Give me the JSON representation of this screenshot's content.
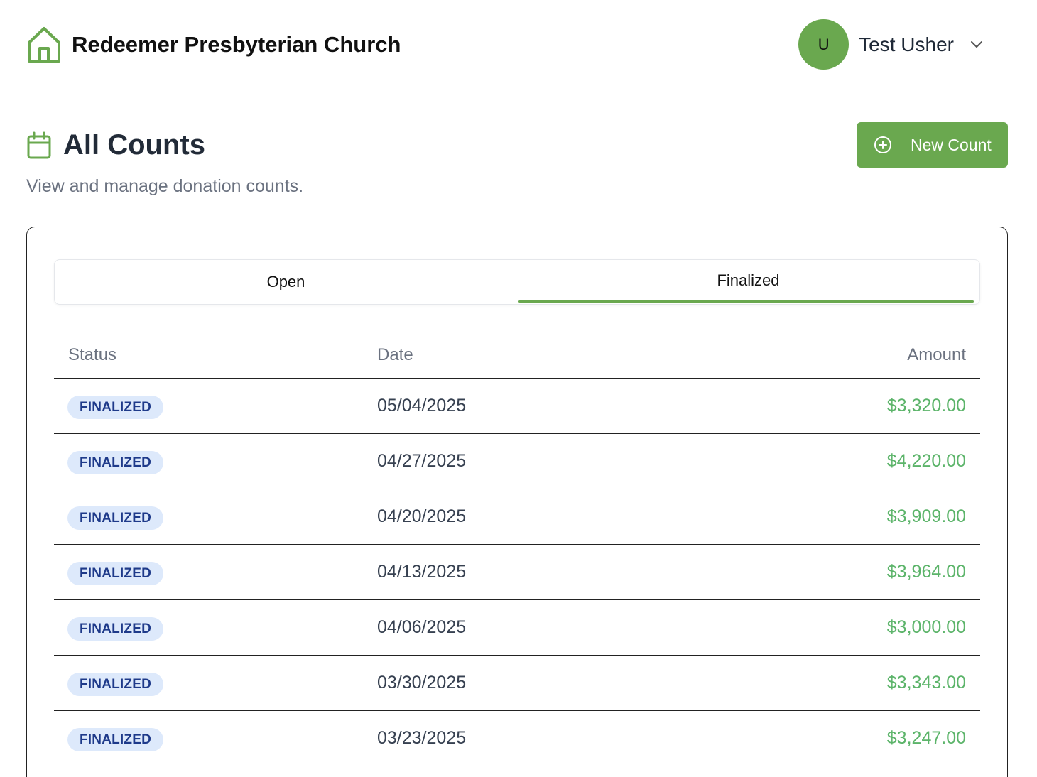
{
  "header": {
    "brand_name": "Redeemer Presbyterian Church",
    "brand_icon": "home-icon",
    "user": {
      "avatar_initial": "U",
      "name": "Test Usher",
      "menu_icon": "chevron-down-icon"
    }
  },
  "page": {
    "title": "All Counts",
    "title_icon": "calendar-icon",
    "subtitle": "View and manage donation counts.",
    "new_button_label": "New Count",
    "new_button_icon": "plus-circle-icon"
  },
  "tabs": [
    {
      "label": "Open",
      "active": false
    },
    {
      "label": "Finalized",
      "active": true
    }
  ],
  "table": {
    "columns": [
      "Status",
      "Date",
      "Amount"
    ],
    "rows": [
      {
        "status": "FINALIZED",
        "date": "05/04/2025",
        "amount": "$3,320.00"
      },
      {
        "status": "FINALIZED",
        "date": "04/27/2025",
        "amount": "$4,220.00"
      },
      {
        "status": "FINALIZED",
        "date": "04/20/2025",
        "amount": "$3,909.00"
      },
      {
        "status": "FINALIZED",
        "date": "04/13/2025",
        "amount": "$3,964.00"
      },
      {
        "status": "FINALIZED",
        "date": "04/06/2025",
        "amount": "$3,000.00"
      },
      {
        "status": "FINALIZED",
        "date": "03/30/2025",
        "amount": "$3,343.00"
      },
      {
        "status": "FINALIZED",
        "date": "03/23/2025",
        "amount": "$3,247.00"
      }
    ]
  },
  "colors": {
    "accent": "#6aa84f",
    "amount": "#5cb46a",
    "badge_bg": "#dde9fb",
    "badge_text": "#1e3a8a"
  }
}
